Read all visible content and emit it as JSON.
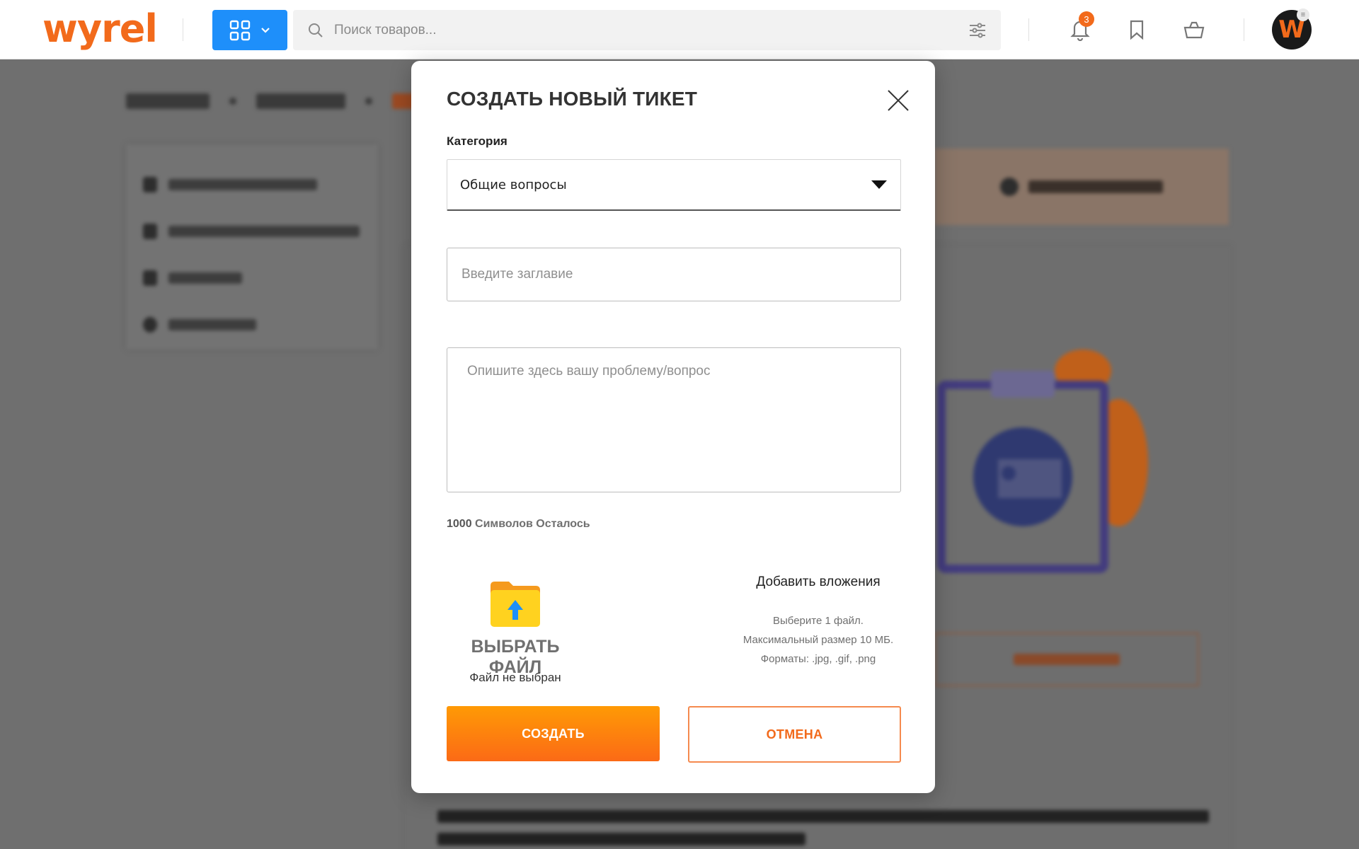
{
  "header": {
    "logo_text": "wyrel",
    "categories_button_icon": "grid-icon",
    "search_placeholder": "Поиск товаров...",
    "notifications_count": "3",
    "avatar_letter": "W",
    "avatar_menu_glyph": "≡"
  },
  "modal": {
    "title": "СОЗДАТЬ НОВЫЙ ТИКЕТ",
    "category_label": "Категория",
    "category_selected": "Общие вопросы",
    "title_placeholder": "Введите заглавие",
    "description_placeholder": "Опишите здесь вашу проблему/вопрос",
    "chars_left_number": "1000",
    "chars_left_text": " Символов Осталось",
    "choose_file_label": "ВЫБРАТЬ ФАЙЛ",
    "no_file_text": "Файл не выбран",
    "attachments_title": "Добавить вложения",
    "attachments_rule_count": "Выберите 1 файл.",
    "attachments_rule_size": "Максимальный размер 10 МБ.",
    "attachments_rule_formats": "Форматы: .jpg, .gif, .png",
    "create_button": "СОЗДАТЬ",
    "cancel_button": "ОТМЕНА"
  },
  "colors": {
    "brand_orange": "#f26a1b",
    "primary_blue": "#1e8ffa",
    "button_gradient_start": "#ff9a05",
    "button_gradient_end": "#fb6a16"
  }
}
